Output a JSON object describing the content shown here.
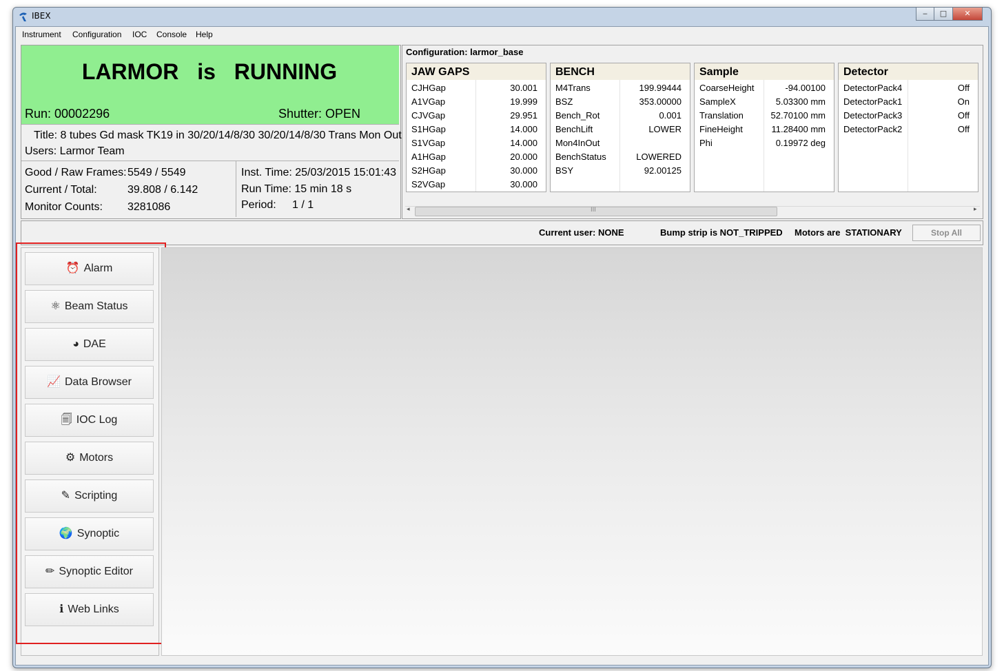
{
  "window": {
    "title": "IBEX"
  },
  "menu": [
    "Instrument",
    "Configuration",
    "IOC",
    "Console",
    "Help"
  ],
  "run_status": {
    "banner_instrument": "LARMOR",
    "banner_is": "is",
    "banner_state": "RUNNING",
    "banner_color": "#90ee90",
    "run": "Run: 00002296",
    "shutter": "Shutter: OPEN",
    "title": "Title: 8 tubes Gd mask TK19 in 30/20/14/8/30 30/20/14/8/30 Trans Mon Out",
    "users": "Users: Larmor Team",
    "good_raw_label": "Good / Raw Frames:",
    "good_raw_value": "5549 / 5549",
    "current_total_label": "Current / Total:",
    "current_total_value": "39.808 / 6.142",
    "monitor_label": "Monitor Counts:",
    "monitor_value": "3281086",
    "inst_time": "Inst. Time: 25/03/2015 15:01:43",
    "run_time": "Run Time: 15 min 18 s",
    "period_label": "Period:",
    "period_value": "1 / 1"
  },
  "configuration": {
    "label": "Configuration: larmor_base",
    "groups": [
      {
        "name": "JAW GAPS",
        "rows": [
          {
            "k": "CJHGap",
            "v": "30.001"
          },
          {
            "k": "A1VGap",
            "v": "19.999"
          },
          {
            "k": "CJVGap",
            "v": "29.951"
          },
          {
            "k": "S1HGap",
            "v": "14.000"
          },
          {
            "k": "S1VGap",
            "v": "14.000"
          },
          {
            "k": "A1HGap",
            "v": "20.000"
          },
          {
            "k": "S2HGap",
            "v": "30.000"
          },
          {
            "k": "S2VGap",
            "v": "30.000"
          }
        ]
      },
      {
        "name": "BENCH",
        "rows": [
          {
            "k": "M4Trans",
            "v": "199.99444"
          },
          {
            "k": "BSZ",
            "v": "353.00000"
          },
          {
            "k": "Bench_Rot",
            "v": "0.001"
          },
          {
            "k": "BenchLift",
            "v": "LOWER"
          },
          {
            "k": "Mon4InOut",
            "v": ""
          },
          {
            "k": "BenchStatus",
            "v": "LOWERED"
          },
          {
            "k": "BSY",
            "v": "92.00125"
          }
        ]
      },
      {
        "name": "Sample",
        "rows": [
          {
            "k": "CoarseHeight",
            "v": "-94.00100"
          },
          {
            "k": "SampleX",
            "v": "5.03300 mm"
          },
          {
            "k": "Translation",
            "v": "52.70100 mm"
          },
          {
            "k": "FineHeight",
            "v": "11.28400 mm"
          },
          {
            "k": "Phi",
            "v": "0.19972 deg"
          }
        ]
      },
      {
        "name": "Detector",
        "rows": [
          {
            "k": "DetectorPack4",
            "v": "Off"
          },
          {
            "k": "DetectorPack1",
            "v": "On"
          },
          {
            "k": "DetectorPack3",
            "v": "Off"
          },
          {
            "k": "DetectorPack2",
            "v": "Off"
          }
        ]
      }
    ],
    "scroll_grip": "III"
  },
  "status_strip": {
    "current_user": "Current user: NONE",
    "bump_strip": "Bump strip is NOT_TRIPPED",
    "motors": "Motors are  STATIONARY",
    "stop_all": "Stop All"
  },
  "perspectives": [
    {
      "label": "Alarm",
      "icon": "alarm-clock-icon",
      "glyph": "⏰"
    },
    {
      "label": "Beam Status",
      "icon": "atom-icon",
      "glyph": "⚛"
    },
    {
      "label": "DAE",
      "icon": "gauge-icon",
      "glyph": "◕"
    },
    {
      "label": "Data Browser",
      "icon": "chart-search-icon",
      "glyph": "📈"
    },
    {
      "label": "IOC Log",
      "icon": "log-icon",
      "glyph": "🗐"
    },
    {
      "label": "Motors",
      "icon": "gear-icon",
      "glyph": "⚙"
    },
    {
      "label": "Scripting",
      "icon": "edit-icon",
      "glyph": "✎"
    },
    {
      "label": "Synoptic",
      "icon": "globe-icon",
      "glyph": "🌍"
    },
    {
      "label": "Synoptic Editor",
      "icon": "pencil-icon",
      "glyph": "✏"
    },
    {
      "label": "Web Links",
      "icon": "info-icon",
      "glyph": "ℹ"
    }
  ]
}
